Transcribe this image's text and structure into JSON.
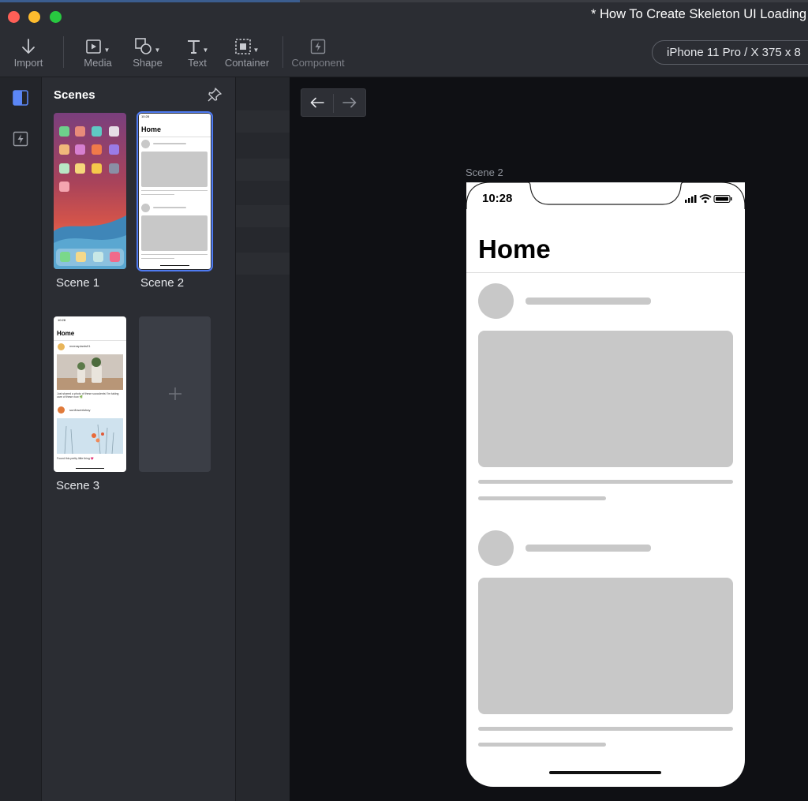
{
  "window": {
    "title": "* How To Create Skeleton UI Loading"
  },
  "toolbar": {
    "import_label": "Import",
    "media_label": "Media",
    "shape_label": "Shape",
    "text_label": "Text",
    "container_label": "Container",
    "component_label": "Component",
    "device_label": "iPhone 11 Pro / X  375 x 8"
  },
  "scenes_panel": {
    "title": "Scenes",
    "items": [
      {
        "label": "Scene 1",
        "selected": false
      },
      {
        "label": "Scene 2",
        "selected": true
      },
      {
        "label": "Scene 3",
        "selected": false
      }
    ],
    "add_icon": "plus-icon"
  },
  "thumb_scene2": {
    "time": "10:28",
    "title": "Home"
  },
  "thumb_scene3": {
    "time": "10:28",
    "title": "Home",
    "user1": "meeraplants01",
    "caption1": "Just shared a photo of these succulents! I'm taking care of these now 🌿",
    "user2": "sunflowerishay",
    "caption2": "Found this pretty little thing 💗"
  },
  "canvas": {
    "scene_caption": "Scene 2",
    "phone": {
      "time": "10:28",
      "title": "Home"
    }
  },
  "colors": {
    "accent": "#4f7bf2",
    "skeleton": "#c8c8c8",
    "panel": "#2b2d33",
    "canvas": "#0f1014"
  }
}
